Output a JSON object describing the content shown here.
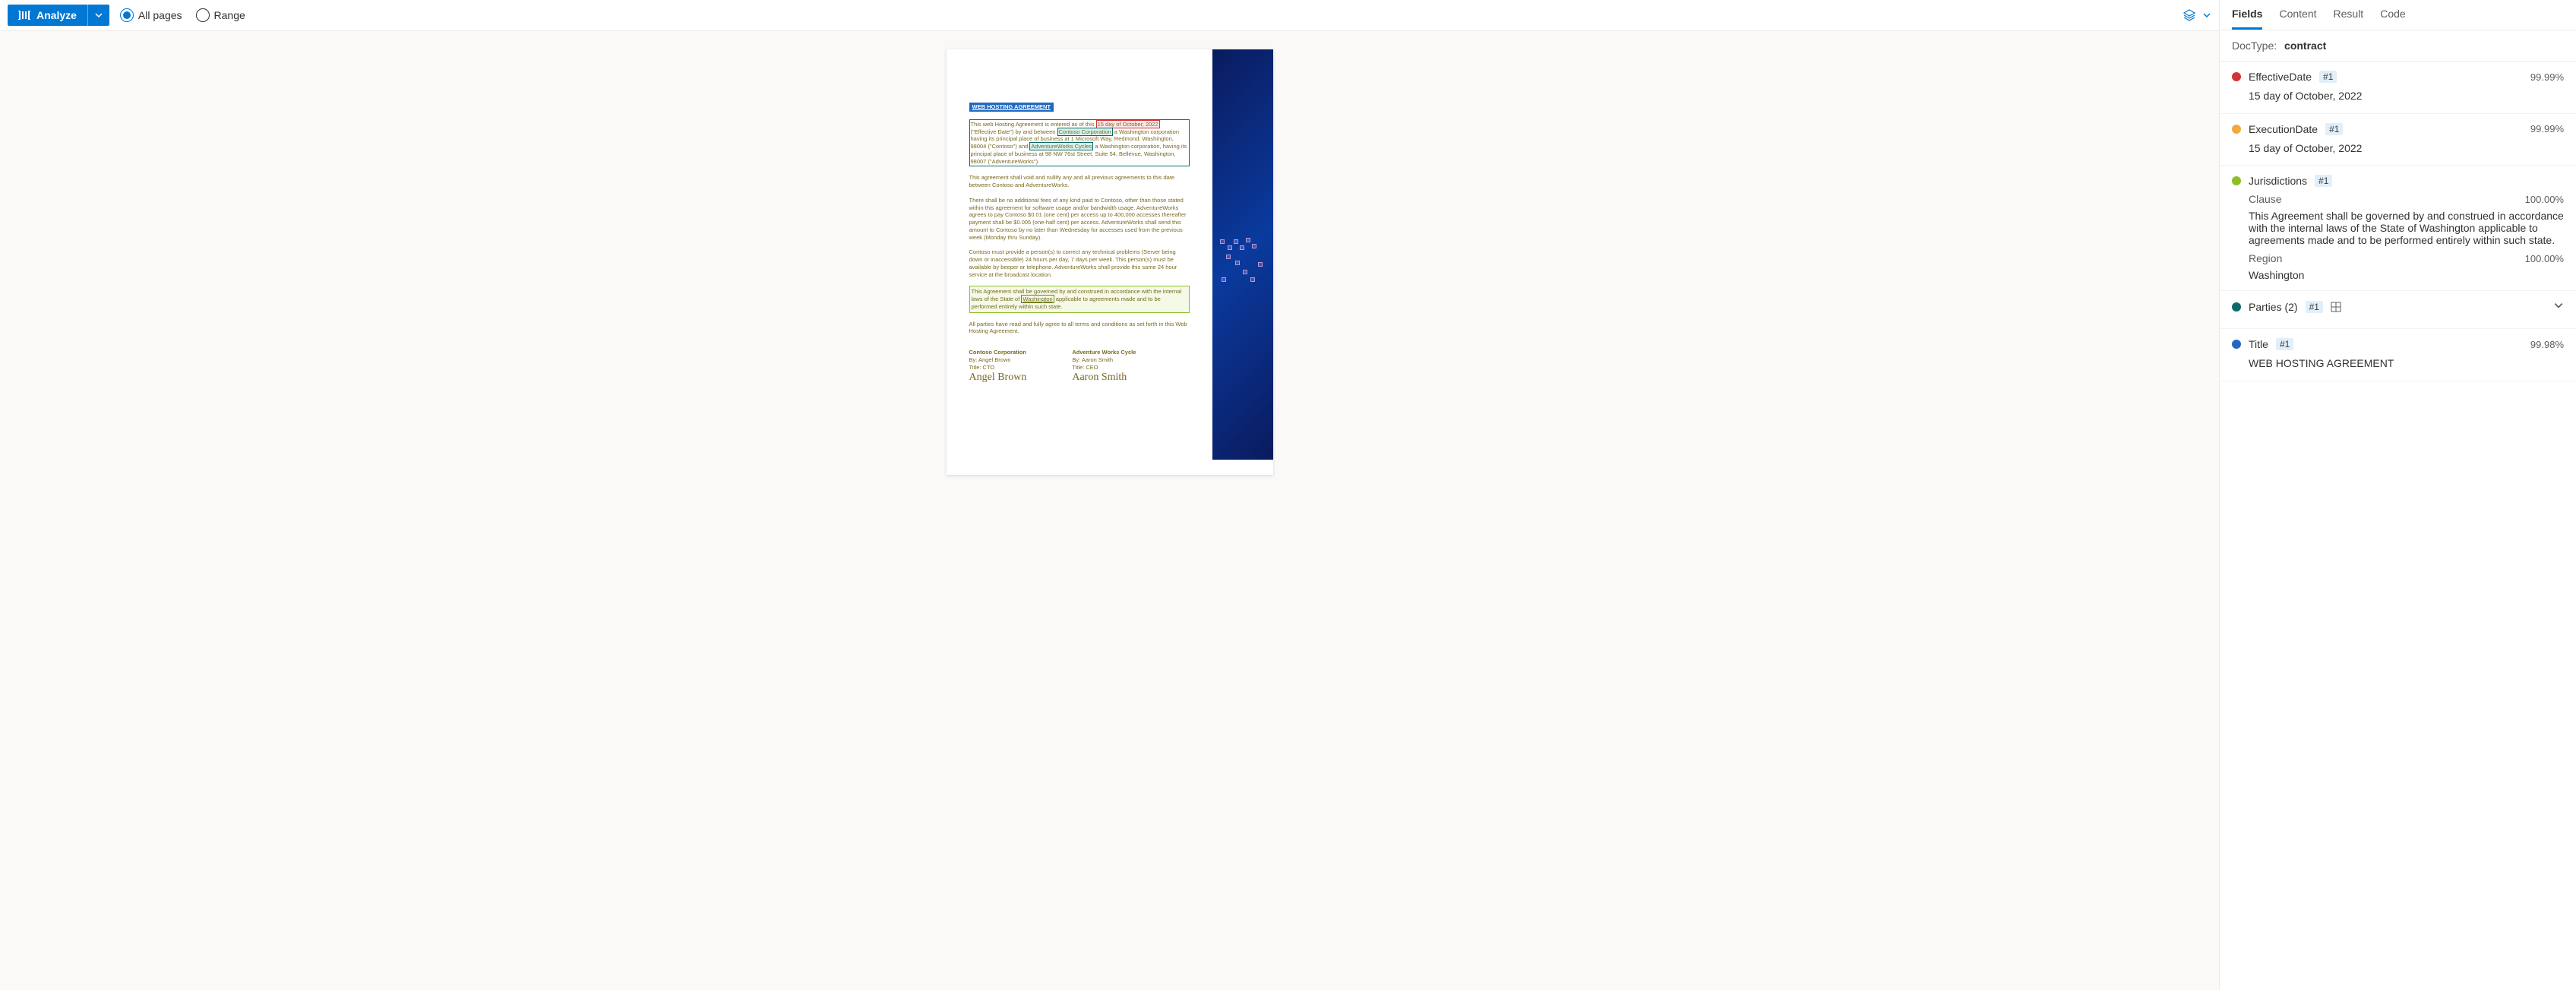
{
  "toolbar": {
    "analyze_label": "Analyze",
    "all_pages_label": "All pages",
    "range_label": "Range"
  },
  "tabs": {
    "fields": "Fields",
    "content": "Content",
    "result": "Result",
    "code": "Code"
  },
  "doctype_label": "DocType:",
  "doctype_value": "contract",
  "fields": [
    {
      "name": "EffectiveDate",
      "badge": "#1",
      "confidence": "99.99%",
      "color": "#d13438",
      "value": "15 day of October, 2022"
    },
    {
      "name": "ExecutionDate",
      "badge": "#1",
      "confidence": "99.99%",
      "color": "#f2a93b",
      "value": "15 day of October, 2022"
    },
    {
      "name": "Jurisdictions",
      "badge": "#1",
      "confidence": "",
      "color": "#8cbf26",
      "sub": [
        {
          "label": "Clause",
          "conf": "100.00%",
          "value": "This Agreement shall be governed by and construed in accordance with the internal laws of the State of Washington applicable to agreements made and to be performed entirely within such state."
        },
        {
          "label": "Region",
          "conf": "100.00%",
          "value": "Washington"
        }
      ]
    },
    {
      "name": "Parties (2)",
      "badge": "#1",
      "confidence": "",
      "color": "#0b6a6a",
      "collapsed": true
    },
    {
      "name": "Title",
      "badge": "#1",
      "confidence": "99.98%",
      "color": "#1f69c1",
      "value": "WEB HOSTING AGREEMENT"
    }
  ],
  "doc": {
    "title": "WEB HOSTING AGREEMENT",
    "intro_a": "This web Hosting Agreement is entered as of this ",
    "date_box": "15 day of October, 2022",
    "intro_b": "(\"Effective Date\") by and between ",
    "party1": "Contoso Corporation",
    "intro_c": " a Washington corporation having its principal place of business at 1 Microsoft Way, Redmond, Washington, 98004 (\"Contoso\") and ",
    "party2": "AdventureWorks Cycles",
    "intro_d": " a Washington corporation, having its principal place of business at 98 NW 76st Street, Suite 54, Bellevue, Washington, 98007 (\"AdventureWorks\").",
    "p2": "This agreement shall void and nullify any and all previous agreements to this date between Contoso and AdventureWorks.",
    "p3": "There shall be no additional fees of any kind paid to Contoso, other than those stated within this agreement for software usage and/or bandwidth usage. AdventureWorks agrees to pay Contoso $0.01 (one cent) per access up to 400,000 accesses thereafter payment shall be $0.005 (one-half cent) per access. AdventureWorks shall send this amount to Contoso by no later than Wednesday for accesses used from the previous week (Monday thru Sunday).",
    "p4": "Contoso must provide a person(s) to correct any technical problems (Server being down or inaccessible) 24 hours per day, 7 days per week. This person(s) must be available by beeper or telephone. AdventureWorks shall provide this same 24 hour service at the broadcast location.",
    "clause_a": "This Agreement shall be governed by and construed in accordance with the internal laws of the State of ",
    "clause_region": "Washington",
    "clause_b": " applicable to agreements made and to be performed entirely within such state.",
    "p6": "All parties have read and fully agree to all terms and conditions as set forth in this Web Hosting Agreement.",
    "sig1": {
      "company": "Contoso Corporation",
      "by": "By: Angel Brown",
      "title": "Title: CTO",
      "sig": "Angel Brown"
    },
    "sig2": {
      "company": "Adventure Works Cycle",
      "by": "By: Aaron Smith",
      "title": "Title: CEO",
      "sig": "Aaron Smith"
    }
  }
}
